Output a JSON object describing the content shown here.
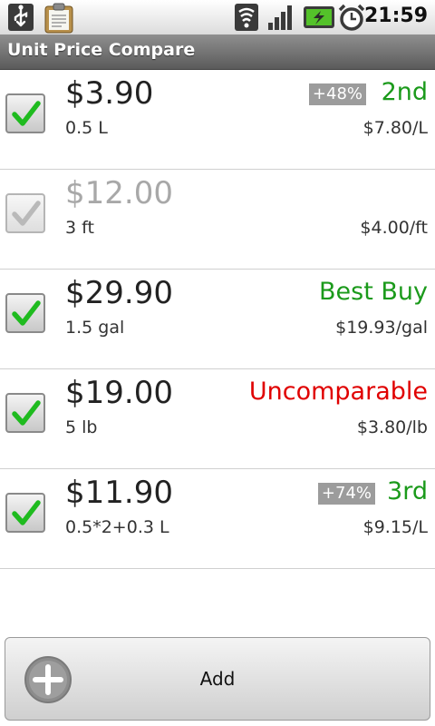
{
  "status_bar": {
    "time": "21:59",
    "icons": [
      "usb-icon",
      "clipboard-icon",
      "wifi-icon",
      "signal-icon",
      "battery-charging-icon",
      "alarm-clock-icon"
    ]
  },
  "app": {
    "title": "Unit Price Compare"
  },
  "items": [
    {
      "price": "$3.90",
      "quantity": "0.5 L",
      "percent_badge": "+48%",
      "rank": "2nd",
      "rank_color": "#1b9a1b",
      "unit_price": "$7.80/L",
      "checked": true,
      "enabled": true
    },
    {
      "price": "$12.00",
      "quantity": "3 ft",
      "percent_badge": "",
      "rank": "",
      "rank_color": "",
      "unit_price": "$4.00/ft",
      "checked": true,
      "enabled": false
    },
    {
      "price": "$29.90",
      "quantity": "1.5 gal",
      "percent_badge": "",
      "rank": "Best Buy",
      "rank_color": "#1b9a1b",
      "unit_price": "$19.93/gal",
      "checked": true,
      "enabled": true
    },
    {
      "price": "$19.00",
      "quantity": "5 lb",
      "percent_badge": "",
      "rank": "Uncomparable",
      "rank_color": "#e00000",
      "unit_price": "$3.80/lb",
      "checked": true,
      "enabled": true
    },
    {
      "price": "$11.90",
      "quantity": "0.5*2+0.3 L",
      "percent_badge": "+74%",
      "rank": "3rd",
      "rank_color": "#1b9a1b",
      "unit_price": "$9.15/L",
      "checked": true,
      "enabled": true
    }
  ],
  "add_button": {
    "label": "Add",
    "icon": "plus-circle-icon"
  }
}
